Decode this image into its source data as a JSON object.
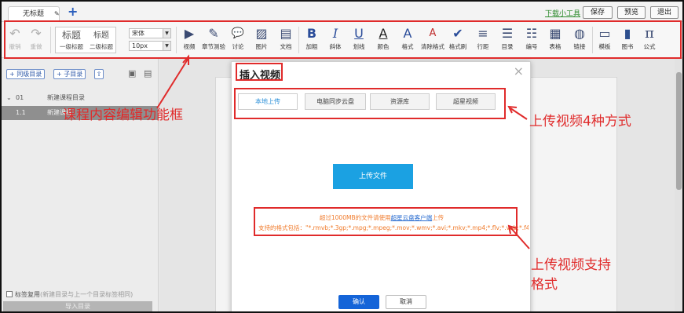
{
  "doc_tab": {
    "title": "无标题",
    "add": "+"
  },
  "header": {
    "tool_link": "下载小工具",
    "buttons": {
      "save": "保存",
      "preview": "预览",
      "exit": "退出"
    }
  },
  "toolbar": {
    "undo": "撤销",
    "redo": "重做",
    "heading1_big": "标题",
    "heading1_small": "一级标题",
    "heading2_big": "标题",
    "heading2_small": "二级标题",
    "font_select": "宋体",
    "size_select": "10px",
    "items": [
      {
        "key": "video",
        "label": "视频",
        "icon": "▶"
      },
      {
        "key": "quiz",
        "label": "章节测验",
        "icon": "✎"
      },
      {
        "key": "discuss",
        "label": "讨论",
        "icon": "💬"
      },
      {
        "key": "image",
        "label": "图片",
        "icon": "▨"
      },
      {
        "key": "doc",
        "label": "文档",
        "icon": "▤"
      },
      {
        "key": "bold",
        "label": "加粗",
        "icon": "B"
      },
      {
        "key": "italic",
        "label": "斜体",
        "icon": "I"
      },
      {
        "key": "underline",
        "label": "划线",
        "icon": "U"
      },
      {
        "key": "color",
        "label": "颜色",
        "icon": "A"
      },
      {
        "key": "format",
        "label": "格式",
        "icon": "A"
      },
      {
        "key": "clear",
        "label": "清除格式",
        "icon": "A"
      },
      {
        "key": "painter",
        "label": "格式刷",
        "icon": "✔"
      },
      {
        "key": "spacing",
        "label": "行距",
        "icon": "≡"
      },
      {
        "key": "toc",
        "label": "目录",
        "icon": "☰"
      },
      {
        "key": "number",
        "label": "编号",
        "icon": "☷"
      },
      {
        "key": "table",
        "label": "表格",
        "icon": "▦"
      },
      {
        "key": "link",
        "label": "链接",
        "icon": "◍"
      },
      {
        "key": "template",
        "label": "模板",
        "icon": "▭"
      },
      {
        "key": "book",
        "label": "图书",
        "icon": "▮"
      },
      {
        "key": "formula",
        "label": "公式",
        "icon": "π"
      }
    ]
  },
  "sidebar": {
    "add_chapter": "+ 同级目录",
    "add_sub": "+ 子目录",
    "up_icon": "⇧",
    "rows": [
      {
        "num": "01",
        "text": "新建课程目录"
      },
      {
        "num": "1.1",
        "text": "新建课程"
      }
    ],
    "tag_reuse_label": "标签复用",
    "tag_reuse_hint": "(新建目录与上一个目录标签相同)",
    "import": "导入目录"
  },
  "modal": {
    "title": "插入视频",
    "close": "×",
    "tabs": [
      "本地上传",
      "电脑同步云盘",
      "资源库",
      "超星视频"
    ],
    "upload_button": "上传文件",
    "note_prefix": "超过1000MB的文件请使用",
    "note_link": "超星云盘客户端",
    "note_suffix": "上传",
    "formats": "支持的格式包括：\"*.rmvb;*.3gp;*.mpg;*.mpeg;*.mov;*.wmv;*.avi;*.mkv;*.mp4;*.flv;*.vob;*.f4v",
    "ok": "确认",
    "cancel": "取消"
  },
  "annotations": {
    "toolbar_label": "课程内容编辑功能框",
    "tabs_label": "上传视频4种方式",
    "formats_label_line1": "上传视频支持",
    "formats_label_line2": "格式",
    "color": "#e02b2b"
  }
}
